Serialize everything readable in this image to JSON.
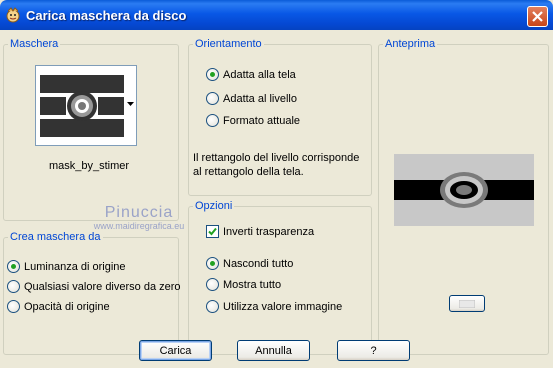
{
  "window": {
    "title": "Carica maschera da disco"
  },
  "mask_group": {
    "legend": "Maschera",
    "mask_name": "mask_by_stimer"
  },
  "create_group": {
    "legend": "Crea maschera da",
    "options": [
      {
        "label": "Luminanza di origine",
        "checked": true
      },
      {
        "label": "Qualsiasi valore diverso da zero",
        "checked": false
      },
      {
        "label": "Opacità di origine",
        "checked": false
      }
    ]
  },
  "orientation_group": {
    "legend": "Orientamento",
    "options": [
      {
        "label": "Adatta alla tela",
        "checked": true
      },
      {
        "label": "Adatta al livello",
        "checked": false
      },
      {
        "label": "Formato attuale",
        "checked": false
      }
    ],
    "description": "Il rettangolo del livello corrisponde al rettangolo della tela."
  },
  "options_group": {
    "legend": "Opzioni",
    "invert_label": "Inverti trasparenza",
    "invert_checked": true,
    "options": [
      {
        "label": "Nascondi tutto",
        "checked": true
      },
      {
        "label": "Mostra tutto",
        "checked": false
      },
      {
        "label": "Utilizza valore immagine",
        "checked": false
      }
    ]
  },
  "preview_group": {
    "legend": "Anteprima"
  },
  "buttons": {
    "ok": "Carica",
    "cancel": "Annulla",
    "help": "?"
  },
  "watermark": {
    "line1": "Pinuccia",
    "line2": "www.maidiregrafica.eu"
  },
  "colors": {
    "titlebar": "#0548d2",
    "legend": "#0046d5",
    "dialog_bg": "#ece9d8",
    "radio_dot": "#21a121"
  }
}
